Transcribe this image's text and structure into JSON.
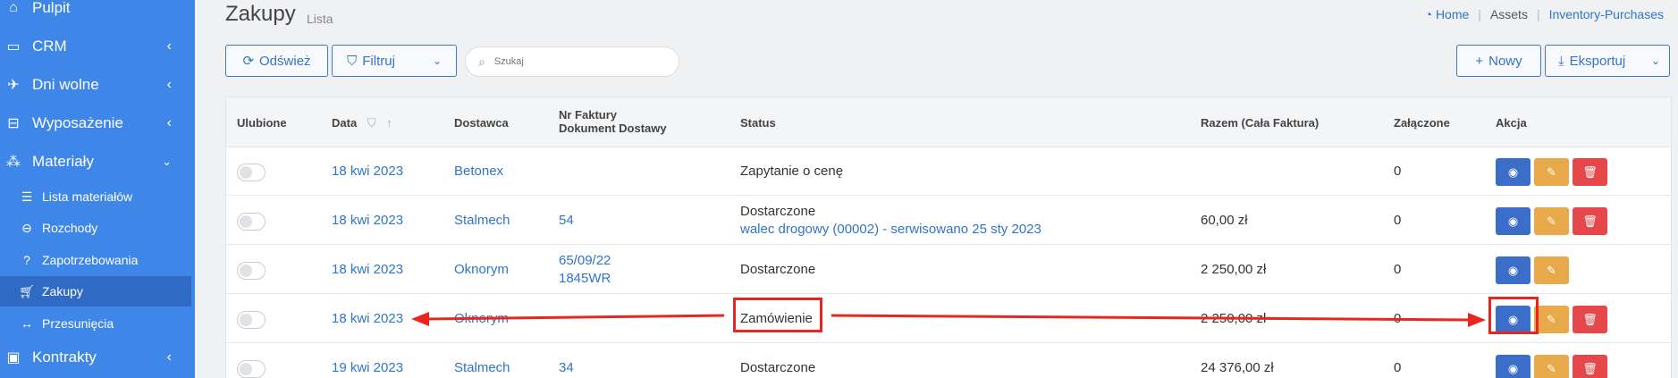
{
  "sidebar": {
    "items": [
      {
        "label": "Pulpit",
        "icon": "home-icon"
      },
      {
        "label": "CRM",
        "icon": "id-card-icon"
      },
      {
        "label": "Dni wolne",
        "icon": "plane-icon"
      },
      {
        "label": "Wyposażenie",
        "icon": "inbox-icon"
      },
      {
        "label": "Materiały",
        "icon": "cubes-icon"
      }
    ],
    "subitems": [
      {
        "label": "Lista materiałów",
        "icon": "list-icon"
      },
      {
        "label": "Rozchody",
        "icon": "minus-circle-icon"
      },
      {
        "label": "Zapotrzebowania",
        "icon": "question-circle-icon"
      },
      {
        "label": "Zakupy",
        "icon": "cart-icon",
        "active": true
      },
      {
        "label": "Przesunięcia",
        "icon": "arrows-h-icon"
      }
    ],
    "bottom": {
      "label": "Kontrakty",
      "icon": "briefcase-icon"
    }
  },
  "header": {
    "title": "Zakupy",
    "subtitle": "Lista"
  },
  "breadcrumb": {
    "home": "Home",
    "assets": "Assets",
    "current": "Inventory-Purchases"
  },
  "toolbar": {
    "refresh": "Odśwież",
    "filter": "Filtruj",
    "search_placeholder": "Szukaj",
    "new": "Nowy",
    "export": "Eksportuj"
  },
  "table": {
    "headers": {
      "fav": "Ulubione",
      "date": "Data",
      "supplier": "Dostawca",
      "invoice_line1": "Nr Faktury",
      "invoice_line2": "Dokument Dostawy",
      "status": "Status",
      "total": "Razem (Cała Faktura)",
      "attached": "Załączone",
      "action": "Akcja"
    },
    "rows": [
      {
        "date": "18 kwi 2023",
        "supplier": "Betonex",
        "invoice1": "",
        "invoice2": "",
        "status": "Zapytanie o cenę",
        "status_link": "",
        "total": "",
        "attached": "0",
        "delete": true
      },
      {
        "date": "18 kwi 2023",
        "supplier": "Stalmech",
        "invoice1": "54",
        "invoice2": "",
        "status": "Dostarczone",
        "status_link": "walec drogowy (00002) - serwisowano 25 sty 2023",
        "total": "60,00 zł",
        "attached": "0",
        "delete": true
      },
      {
        "date": "18 kwi 2023",
        "supplier": "Oknorym",
        "invoice1": "65/09/22",
        "invoice2": "1845WR",
        "status": "Dostarczone",
        "status_link": "",
        "total": "2 250,00 zł",
        "attached": "0",
        "delete": false
      },
      {
        "date": "18 kwi 2023",
        "supplier": "Oknorym",
        "invoice1": "",
        "invoice2": "",
        "status": "Zamówienie",
        "status_link": "",
        "total": "2 250,00 zł",
        "attached": "0",
        "delete": true
      },
      {
        "date": "19 kwi 2023",
        "supplier": "Stalmech",
        "invoice1": "34",
        "invoice2": "",
        "status": "Dostarczone",
        "status_link": "",
        "total": "24 376,00 zł",
        "attached": "0",
        "delete": true
      }
    ]
  },
  "colors": {
    "sidebar": "#3e86e8",
    "accent": "#2f75c9",
    "view": "#3b6ec9",
    "edit": "#e7a94a",
    "delete": "#e6474a",
    "annotation": "#e8261f"
  }
}
